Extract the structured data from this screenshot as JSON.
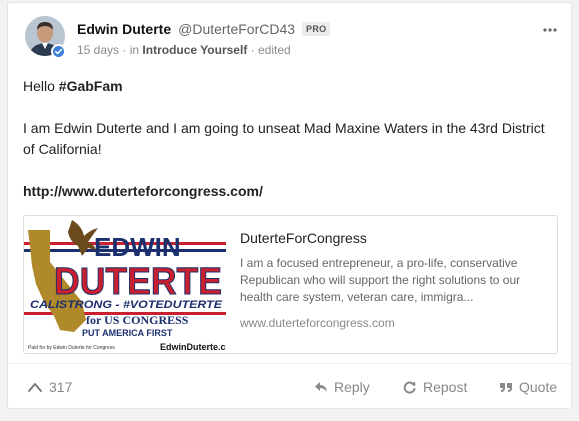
{
  "post": {
    "display_name": "Edwin Duterte",
    "username": "@DuterteForCD43",
    "badge": "PRO",
    "age": "15 days",
    "in_label": "in",
    "group": "Introduce Yourself",
    "edited": "edited",
    "separator": "·",
    "body": {
      "greeting": "Hello ",
      "hashtag": "#GabFam",
      "statement": "I am Edwin Duterte and I am going to unseat Mad Maxine Waters in the 43rd District of California!",
      "url": "http://www.duterteforcongress.com/"
    },
    "preview": {
      "title": "DuterteForCongress",
      "description": "I am a focused entrepreneur, a pro-life, conservative Republican who will support the right solutions to our health care system, veteran care, immigra...",
      "domain": "www.duterteforcongress.com",
      "image": {
        "name": "EDWIN",
        "surname": "DUTERTE",
        "slogan": "CALISTRONG - #VOTEDUTERTE",
        "office": "for US CONGRESS",
        "motto": "PUT AMERICA FIRST",
        "site": "EdwinDuterte.com",
        "fine_print": "Paid for by Edwin Duterte for Congress"
      }
    },
    "actions": {
      "score": "317",
      "reply": "Reply",
      "repost": "Repost",
      "quote": "Quote"
    }
  },
  "colors": {
    "accent": "#3b7fd9",
    "flag_red": "#c8202f",
    "flag_blue": "#1c2f6e",
    "gold": "#b08a2a"
  },
  "icons": [
    "more-icon",
    "verified-icon",
    "upvote-icon",
    "reply-icon",
    "repost-icon",
    "quote-icon"
  ]
}
